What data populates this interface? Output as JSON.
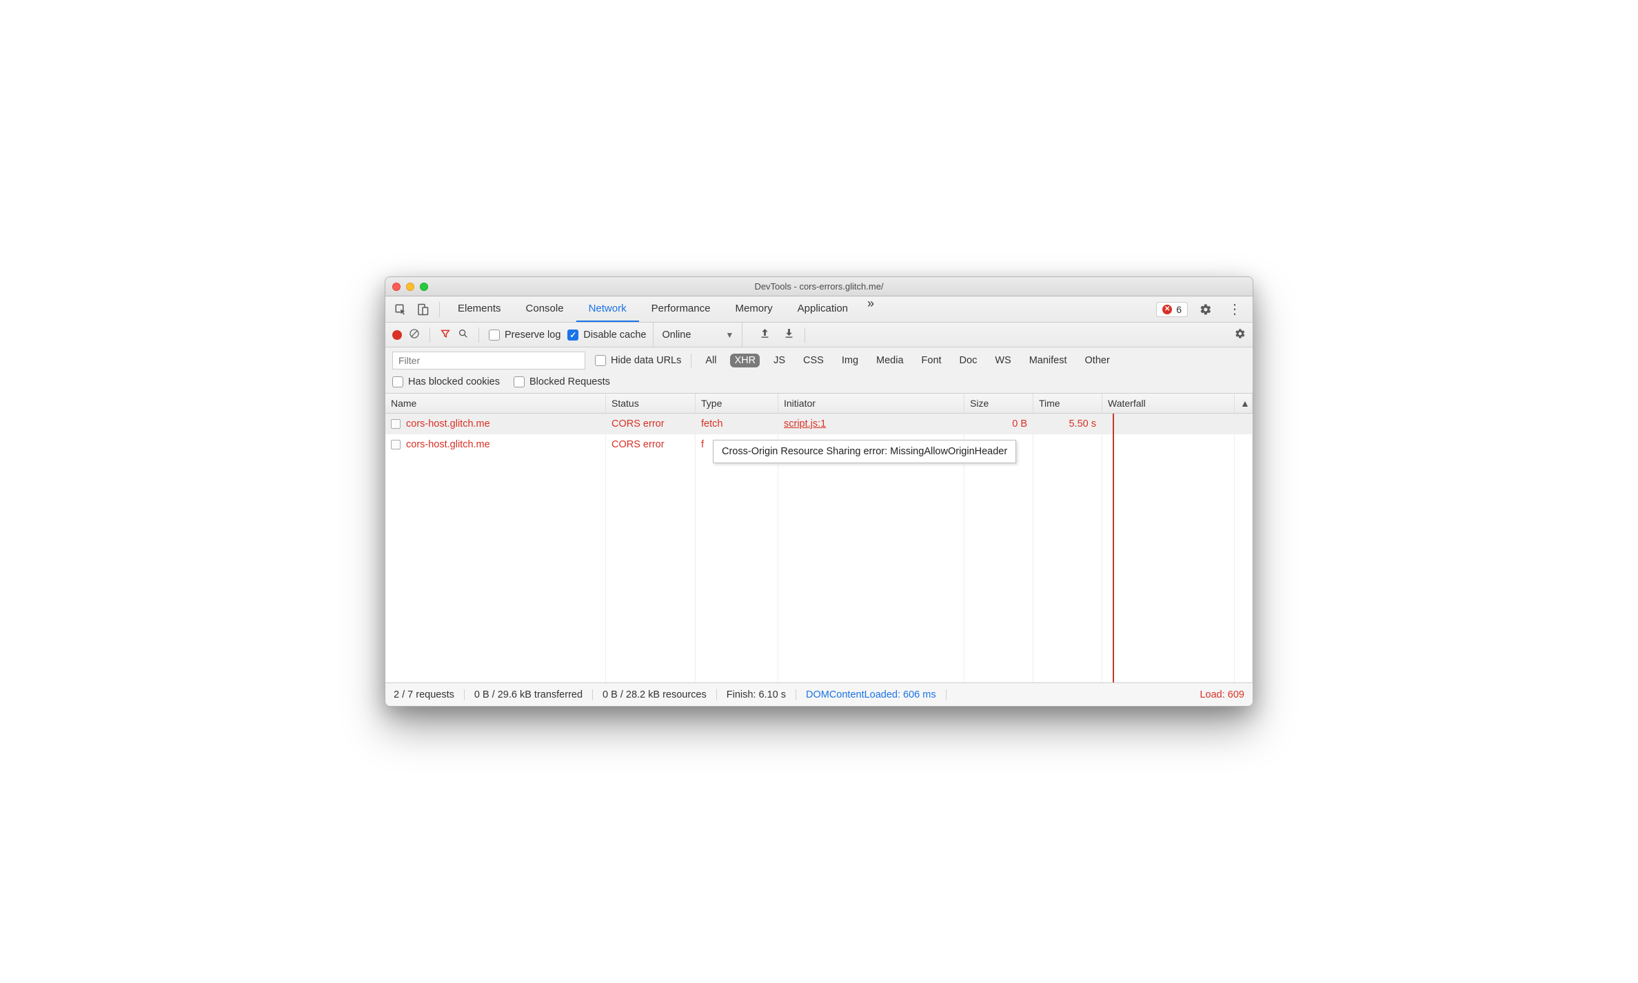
{
  "titlebar": {
    "title": "DevTools - cors-errors.glitch.me/"
  },
  "tabs": {
    "items": [
      "Elements",
      "Console",
      "Network",
      "Performance",
      "Memory",
      "Application"
    ],
    "activeIndex": 2,
    "more": "»",
    "errorCount": "6"
  },
  "toolbar": {
    "preserve_log": "Preserve log",
    "disable_cache": "Disable cache",
    "throttle": "Online"
  },
  "filter": {
    "placeholder": "Filter",
    "hide_data_urls": "Hide data URLs",
    "types": [
      "All",
      "XHR",
      "JS",
      "CSS",
      "Img",
      "Media",
      "Font",
      "Doc",
      "WS",
      "Manifest",
      "Other"
    ],
    "activeTypeIndex": 1,
    "has_blocked_cookies": "Has blocked cookies",
    "blocked_requests": "Blocked Requests"
  },
  "tableHeaders": {
    "name": "Name",
    "status": "Status",
    "type": "Type",
    "initiator": "Initiator",
    "size": "Size",
    "time": "Time",
    "waterfall": "Waterfall",
    "sort": "▲"
  },
  "rows": [
    {
      "name": "cors-host.glitch.me",
      "status": "CORS error",
      "type": "fetch",
      "initiator": "script.js:1",
      "size": "0 B",
      "time": "5.50 s"
    },
    {
      "name": "cors-host.glitch.me",
      "status": "CORS error",
      "type": "f",
      "initiator": "",
      "size": "",
      "time": ""
    }
  ],
  "tooltip": "Cross-Origin Resource Sharing error: MissingAllowOriginHeader",
  "statusbar": {
    "requests": "2 / 7 requests",
    "transferred": "0 B / 29.6 kB transferred",
    "resources": "0 B / 28.2 kB resources",
    "finish": "Finish: 6.10 s",
    "dcl": "DOMContentLoaded: 606 ms",
    "load": "Load: 609"
  }
}
